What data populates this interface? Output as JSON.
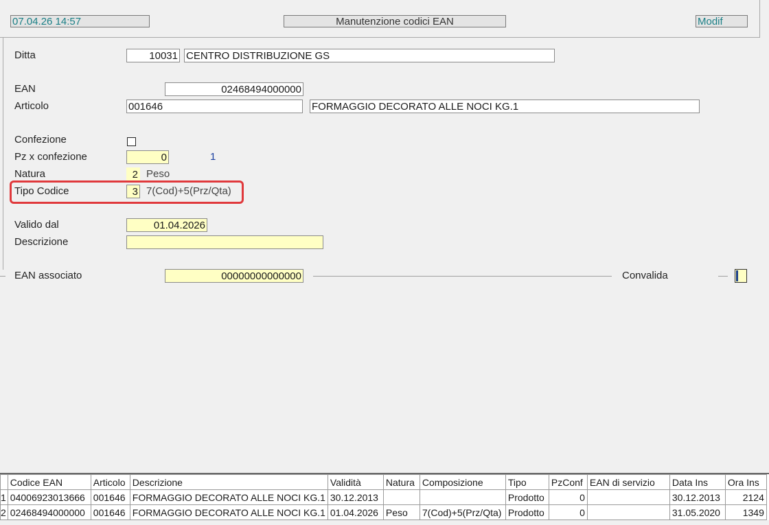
{
  "header": {
    "datetime": "07.04.26 14:57",
    "title": "Manutenzione codici EAN",
    "mode": "Modif"
  },
  "form": {
    "ditta": {
      "label": "Ditta",
      "code": "10031",
      "name": "CENTRO DISTRIBUZIONE GS"
    },
    "ean": {
      "label": "EAN",
      "value": "02468494000000"
    },
    "articolo": {
      "label": "Articolo",
      "code": "001646",
      "description": "FORMAGGIO DECORATO ALLE NOCI KG.1"
    },
    "confezione": {
      "label": "Confezione",
      "checked": false
    },
    "pz_confezione": {
      "label": "Pz x confezione",
      "value": "0",
      "extra": "1"
    },
    "natura": {
      "label": "Natura",
      "value": "2",
      "text": "Peso"
    },
    "tipo_codice": {
      "label": "Tipo Codice",
      "value": "3",
      "text": "7(Cod)+5(Prz/Qta)"
    },
    "valido_dal": {
      "label": "Valido  dal",
      "value": "01.04.2026"
    },
    "descrizione": {
      "label": "Descrizione",
      "value": ""
    },
    "ean_associato": {
      "label": "EAN associato",
      "value": "00000000000000"
    },
    "convalida": {
      "label": "Convalida"
    }
  },
  "grid": {
    "columns": [
      "",
      "Codice EAN",
      "Articolo",
      "Descrizione",
      "Validità",
      "Natura",
      "Composizione",
      "Tipo",
      "PzConf",
      "EAN di servizio",
      "Data  Ins",
      "Ora  Ins"
    ],
    "rows": [
      [
        "1",
        "04006923013666",
        "001646",
        "FORMAGGIO DECORATO ALLE NOCI KG.1",
        "30.12.2013",
        "",
        "",
        "Prodotto",
        "0",
        "",
        "30.12.2013",
        "2124"
      ],
      [
        "2",
        "02468494000000",
        "001646",
        "FORMAGGIO DECORATO ALLE NOCI KG.1",
        "01.04.2026",
        "Peso",
        "7(Cod)+5(Prz/Qta)",
        "Prodotto",
        "0",
        "",
        "31.05.2020",
        "1349"
      ]
    ]
  },
  "colors": {
    "accent_teal": "#1a7f86",
    "highlight_red": "#e0393c",
    "field_yellow": "#ffffc4"
  }
}
